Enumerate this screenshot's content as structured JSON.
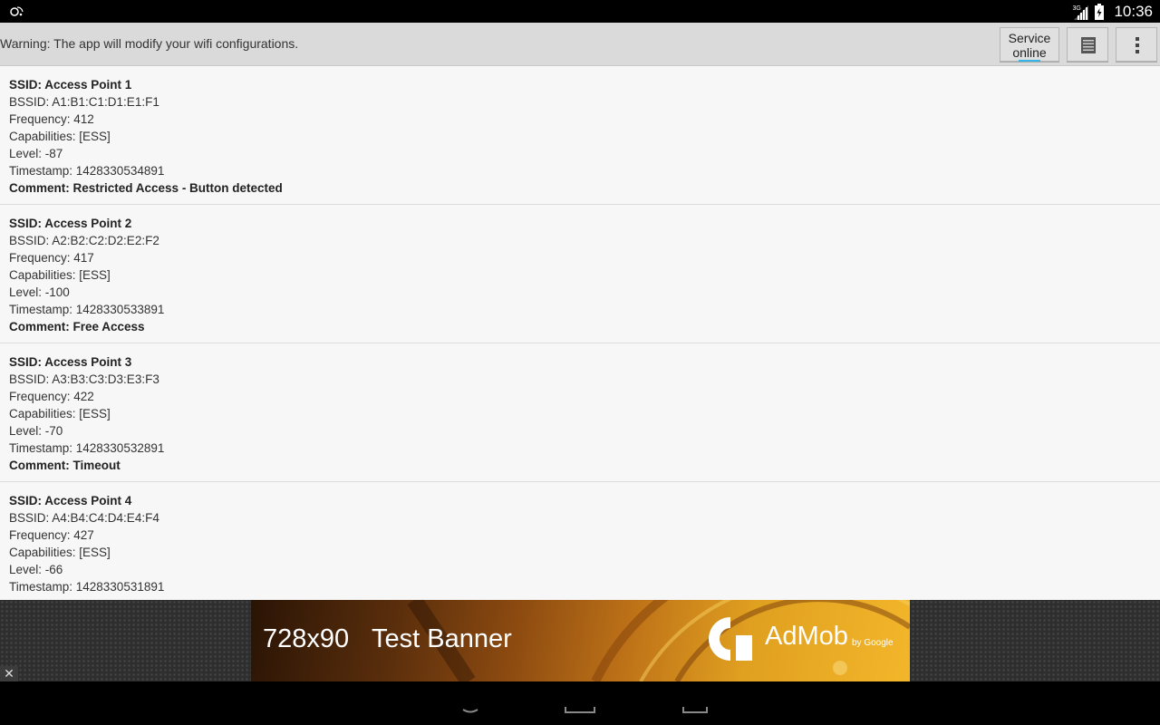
{
  "status_bar": {
    "time": "10:36",
    "network": "3G",
    "icons": [
      "app-notification-icon",
      "signal-icon",
      "battery-icon"
    ]
  },
  "action_bar": {
    "warning": "Warning: The app will modify your wifi configurations.",
    "service_button": {
      "line1": "Service",
      "line2": "online"
    },
    "log_icon": "list-icon",
    "overflow_icon": "overflow-menu-icon",
    "accent_color": "#33b5e5"
  },
  "access_points": [
    {
      "ssid": "SSID: Access Point 1",
      "bssid": "BSSID: A1:B1:C1:D1:E1:F1",
      "frequency": "Frequency: 412",
      "capabilities": "Capabilities: [ESS]",
      "level": "Level: -87",
      "timestamp": "Timestamp: 1428330534891",
      "comment": "Comment: Restricted Access - Button detected"
    },
    {
      "ssid": "SSID: Access Point 2",
      "bssid": "BSSID: A2:B2:C2:D2:E2:F2",
      "frequency": "Frequency: 417",
      "capabilities": "Capabilities: [ESS]",
      "level": "Level: -100",
      "timestamp": "Timestamp: 1428330533891",
      "comment": "Comment: Free Access"
    },
    {
      "ssid": "SSID: Access Point 3",
      "bssid": "BSSID: A3:B3:C3:D3:E3:F3",
      "frequency": "Frequency: 422",
      "capabilities": "Capabilities: [ESS]",
      "level": "Level: -70",
      "timestamp": "Timestamp: 1428330532891",
      "comment": "Comment: Timeout"
    },
    {
      "ssid": "SSID: Access Point 4",
      "bssid": "BSSID: A4:B4:C4:D4:E4:F4",
      "frequency": "Frequency: 427",
      "capabilities": "Capabilities: [ESS]",
      "level": "Level: -66",
      "timestamp": "Timestamp: 1428330531891"
    }
  ],
  "ad": {
    "size": "728x90",
    "label": "Test Banner",
    "brand": "AdMob",
    "brand_sub": "by Google",
    "close_icon": "close-icon"
  }
}
